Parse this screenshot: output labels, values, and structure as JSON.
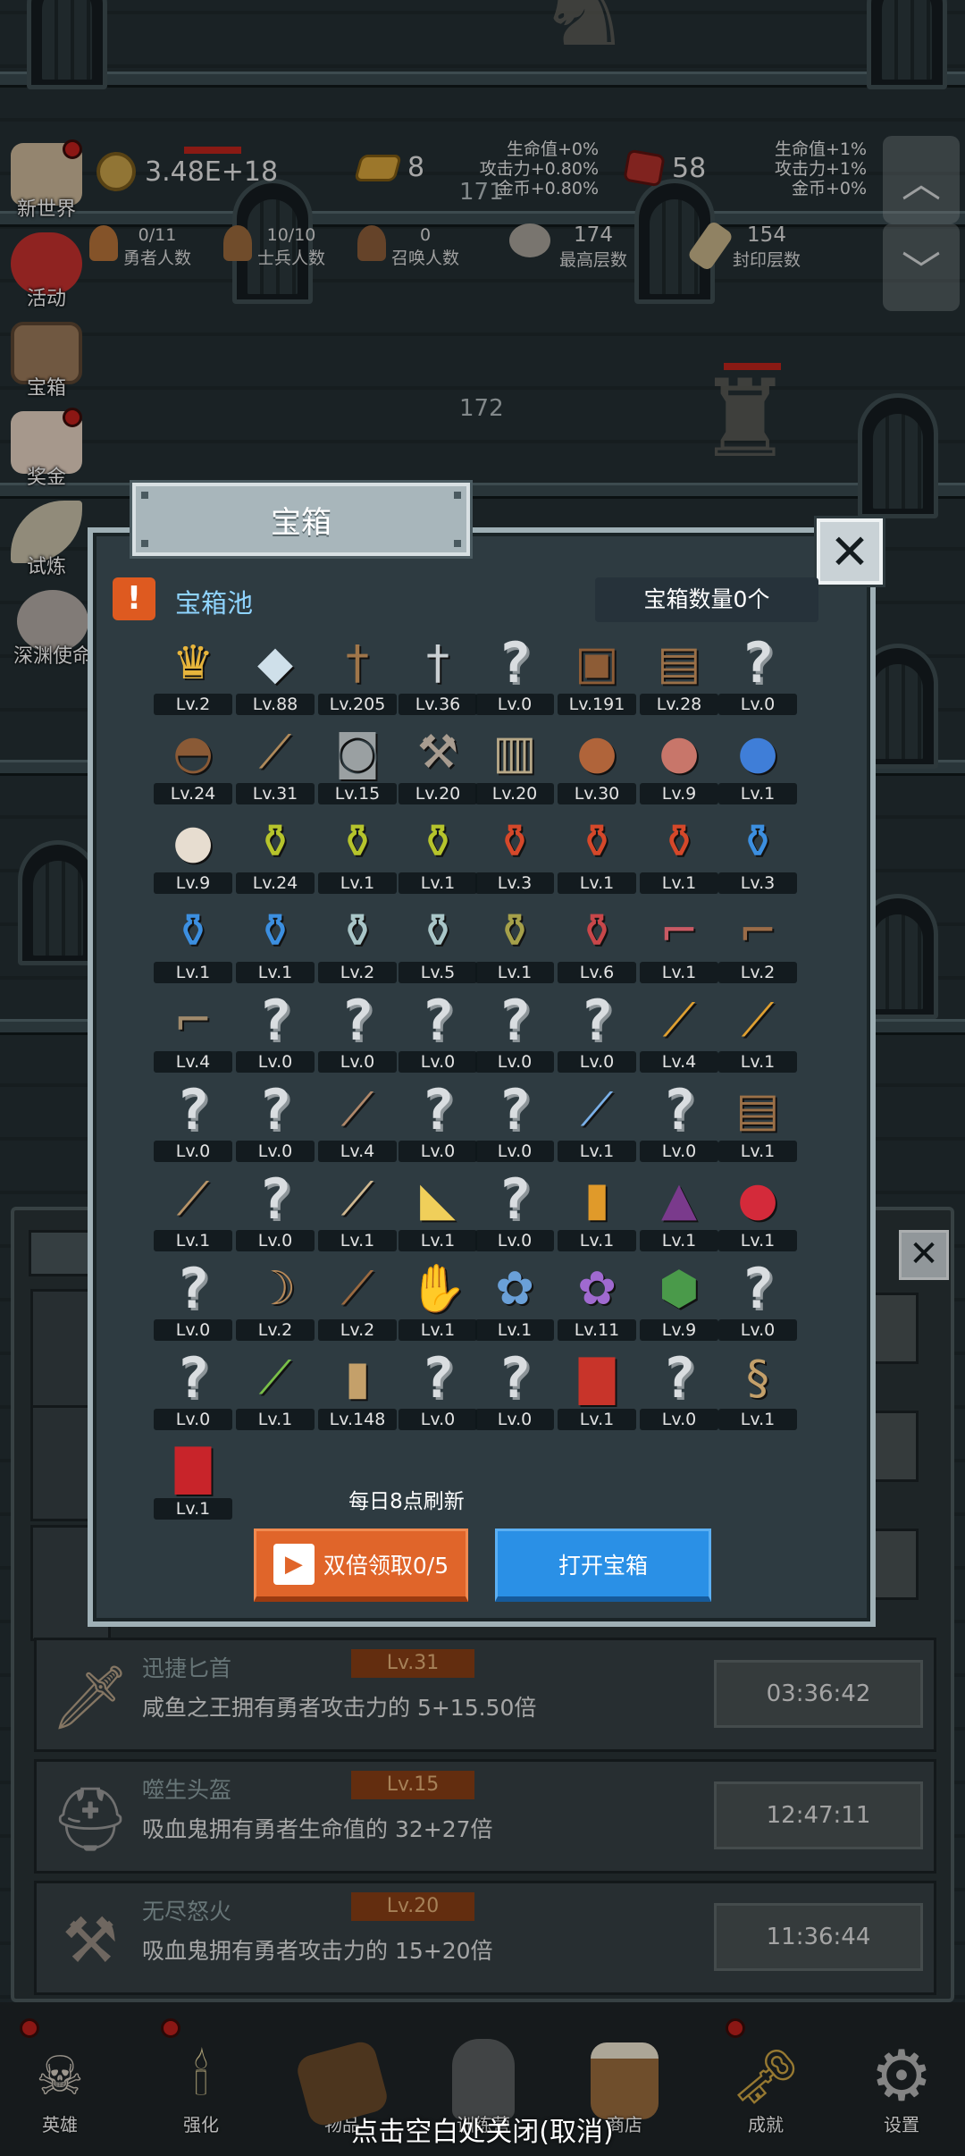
{
  "top": {
    "gold": "3.48E+18",
    "gold_icon": "gold-coin-icon",
    "bars": "8",
    "bars_icon": "gold-bar-icon",
    "gems": "58",
    "gems_icon": "red-gem-icon",
    "bonus_left": [
      "生命值+0%",
      "攻击力+0.80%",
      "金币+0.80%"
    ],
    "bonus_right": [
      "生命值+1%",
      "攻击力+1%",
      "金币+0%"
    ],
    "hero_count": {
      "value": "0/11",
      "label": "勇者人数"
    },
    "soldier_count": {
      "value": "10/10",
      "label": "士兵人数"
    },
    "summon_count": {
      "value": "0",
      "label": "召唤人数"
    },
    "max_floor": {
      "value": "174",
      "label": "最高层数"
    },
    "seal_floor": {
      "value": "154",
      "label": "封印层数"
    }
  },
  "floors": {
    "a": "171",
    "b": "172"
  },
  "side": [
    {
      "label": "新世界",
      "icon": "scroll-map-icon"
    },
    {
      "label": "活动",
      "icon": "heart-icon"
    },
    {
      "label": "宝箱",
      "icon": "treasure-chest-icon"
    },
    {
      "label": "奖金",
      "icon": "envelope-icon"
    },
    {
      "label": "试炼",
      "icon": "feather-icon"
    },
    {
      "label": "深渊使命",
      "icon": "orb-icon"
    }
  ],
  "modal": {
    "tab_title": "宝箱",
    "pool_title": "宝箱池",
    "chest_count": "宝箱数量0个",
    "refresh_text": "每日8点刷新",
    "double_button": "双倍领取0/5",
    "open_button": "打开宝箱"
  },
  "items": [
    {
      "lv": "Lv.2",
      "icon": "crown-icon"
    },
    {
      "lv": "Lv.88",
      "icon": "diamond-icon"
    },
    {
      "lv": "Lv.205",
      "icon": "wooden-sword-icon"
    },
    {
      "lv": "Lv.36",
      "icon": "iron-sword-icon"
    },
    {
      "lv": "Lv.0",
      "icon": "unknown-icon"
    },
    {
      "lv": "Lv.191",
      "icon": "leather-armor-icon"
    },
    {
      "lv": "Lv.28",
      "icon": "backpack-icon"
    },
    {
      "lv": "Lv.0",
      "icon": "unknown-icon"
    },
    {
      "lv": "Lv.24",
      "icon": "leather-helmet-icon"
    },
    {
      "lv": "Lv.31",
      "icon": "dagger-icon"
    },
    {
      "lv": "Lv.15",
      "icon": "knight-helmet-icon"
    },
    {
      "lv": "Lv.20",
      "icon": "hammer-icon"
    },
    {
      "lv": "Lv.20",
      "icon": "great-helm-icon"
    },
    {
      "lv": "Lv.30",
      "icon": "ham-icon"
    },
    {
      "lv": "Lv.9",
      "icon": "steak-icon"
    },
    {
      "lv": "Lv.1",
      "icon": "blue-pouch-icon"
    },
    {
      "lv": "Lv.9",
      "icon": "flour-sack-icon"
    },
    {
      "lv": "Lv.24",
      "icon": "yellow-potion-icon"
    },
    {
      "lv": "Lv.1",
      "icon": "yellow-potion-icon"
    },
    {
      "lv": "Lv.1",
      "icon": "yellow-potion-icon"
    },
    {
      "lv": "Lv.3",
      "icon": "red-potion-icon"
    },
    {
      "lv": "Lv.1",
      "icon": "red-potion-icon"
    },
    {
      "lv": "Lv.1",
      "icon": "red-potion-icon"
    },
    {
      "lv": "Lv.3",
      "icon": "blue-potion-icon"
    },
    {
      "lv": "Lv.1",
      "icon": "blue-potion-icon"
    },
    {
      "lv": "Lv.1",
      "icon": "blue-potion-icon"
    },
    {
      "lv": "Lv.2",
      "icon": "glass-bottle-icon"
    },
    {
      "lv": "Lv.5",
      "icon": "glass-bottle-icon"
    },
    {
      "lv": "Lv.1",
      "icon": "olive-bottle-icon"
    },
    {
      "lv": "Lv.6",
      "icon": "red-bottle-icon"
    },
    {
      "lv": "Lv.1",
      "icon": "winged-boot-icon"
    },
    {
      "lv": "Lv.2",
      "icon": "boot-icon"
    },
    {
      "lv": "Lv.4",
      "icon": "shoe-icon"
    },
    {
      "lv": "Lv.0",
      "icon": "unknown-icon"
    },
    {
      "lv": "Lv.0",
      "icon": "unknown-icon"
    },
    {
      "lv": "Lv.0",
      "icon": "unknown-icon"
    },
    {
      "lv": "Lv.0",
      "icon": "unknown-icon"
    },
    {
      "lv": "Lv.0",
      "icon": "unknown-icon"
    },
    {
      "lv": "Lv.4",
      "icon": "torch-icon"
    },
    {
      "lv": "Lv.1",
      "icon": "torch-icon"
    },
    {
      "lv": "Lv.0",
      "icon": "unknown-icon"
    },
    {
      "lv": "Lv.0",
      "icon": "unknown-icon"
    },
    {
      "lv": "Lv.4",
      "icon": "staff-icon"
    },
    {
      "lv": "Lv.0",
      "icon": "unknown-icon"
    },
    {
      "lv": "Lv.0",
      "icon": "unknown-icon"
    },
    {
      "lv": "Lv.1",
      "icon": "scepter-icon"
    },
    {
      "lv": "Lv.0",
      "icon": "unknown-icon"
    },
    {
      "lv": "Lv.1",
      "icon": "backpack-icon"
    },
    {
      "lv": "Lv.1",
      "icon": "shovel-icon"
    },
    {
      "lv": "Lv.0",
      "icon": "unknown-icon"
    },
    {
      "lv": "Lv.1",
      "icon": "club-icon"
    },
    {
      "lv": "Lv.1",
      "icon": "cheese-icon"
    },
    {
      "lv": "Lv.0",
      "icon": "unknown-icon"
    },
    {
      "lv": "Lv.1",
      "icon": "honey-jar-icon"
    },
    {
      "lv": "Lv.1",
      "icon": "crystal-pyramid-icon"
    },
    {
      "lv": "Lv.1",
      "icon": "red-button-icon"
    },
    {
      "lv": "Lv.0",
      "icon": "unknown-icon"
    },
    {
      "lv": "Lv.2",
      "icon": "bow-icon"
    },
    {
      "lv": "Lv.2",
      "icon": "quiver-icon"
    },
    {
      "lv": "Lv.1",
      "icon": "fire-gauntlet-icon"
    },
    {
      "lv": "Lv.1",
      "icon": "blue-spirit-icon"
    },
    {
      "lv": "Lv.11",
      "icon": "purple-spirit-icon"
    },
    {
      "lv": "Lv.9",
      "icon": "emblem-icon"
    },
    {
      "lv": "Lv.0",
      "icon": "unknown-icon"
    },
    {
      "lv": "Lv.0",
      "icon": "unknown-icon"
    },
    {
      "lv": "Lv.1",
      "icon": "green-wand-icon"
    },
    {
      "lv": "Lv.148",
      "icon": "beer-mug-icon"
    },
    {
      "lv": "Lv.0",
      "icon": "unknown-icon"
    },
    {
      "lv": "Lv.0",
      "icon": "unknown-icon"
    },
    {
      "lv": "Lv.1",
      "icon": "red-book-icon"
    },
    {
      "lv": "Lv.0",
      "icon": "unknown-icon"
    },
    {
      "lv": "Lv.1",
      "icon": "whip-icon"
    },
    {
      "lv": "Lv.1",
      "icon": "red-card-icon"
    }
  ],
  "list": [
    {
      "name": "迅捷匕首",
      "level": "Lv.31",
      "desc": "咸鱼之王拥有勇者攻击力的 5+15.50倍",
      "time": "03:36:42",
      "icon": "dagger-icon"
    },
    {
      "name": "噬生头盔",
      "level": "Lv.15",
      "desc": "吸血鬼拥有勇者生命值的 32+27倍",
      "time": "12:47:11",
      "icon": "knight-helmet-icon"
    },
    {
      "name": "无尽怒火",
      "level": "Lv.20",
      "desc": "吸血鬼拥有勇者攻击力的 15+20倍",
      "time": "11:36:44",
      "icon": "hammer-icon"
    }
  ],
  "nav": [
    {
      "label": "英雄",
      "icon": "skull-icon"
    },
    {
      "label": "强化",
      "icon": "candle-icon"
    },
    {
      "label": "物品",
      "icon": "book-icon"
    },
    {
      "label": "训练营",
      "icon": "lantern-icon"
    },
    {
      "label": "商店",
      "icon": "beer-mug-icon"
    },
    {
      "label": "成就",
      "icon": "key-icon"
    },
    {
      "label": "设置",
      "icon": "gear-icon"
    }
  ],
  "close_hint": "点击空白处关闭(取消)",
  "colors": {
    "accent_orange": "#e0652a",
    "accent_blue": "#2a90e6",
    "hp_red": "#c0241d",
    "title_blue": "#8fd4ff"
  }
}
